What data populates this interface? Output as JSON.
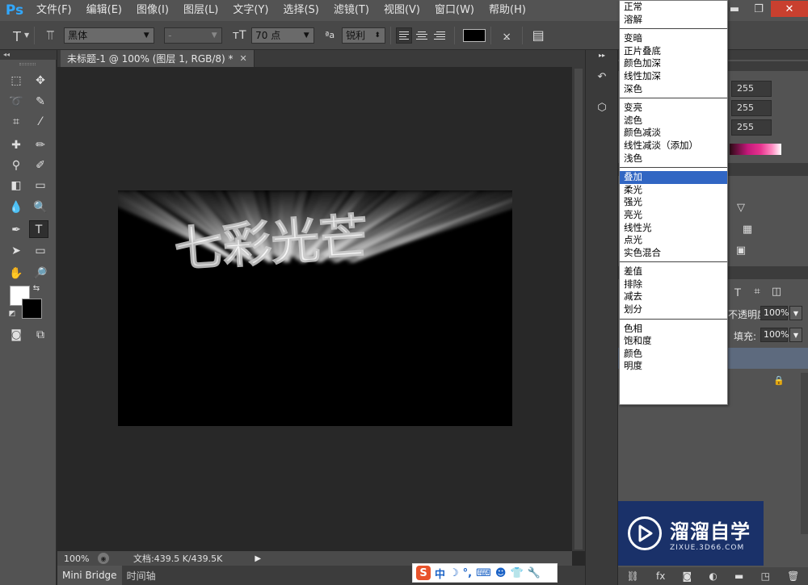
{
  "app": {
    "logo": "Ps"
  },
  "menubar": {
    "items": [
      "文件(F)",
      "编辑(E)",
      "图像(I)",
      "图层(L)",
      "文字(Y)",
      "选择(S)",
      "滤镜(T)",
      "视图(V)",
      "窗口(W)",
      "帮助(H)"
    ]
  },
  "options": {
    "font_family": "黑体",
    "font_style": "-",
    "font_size": "70 点",
    "aa_label": "ªa",
    "anti_alias": "锐利",
    "text_color": "#000000"
  },
  "document": {
    "tab_title": "未标题-1 @ 100% (图层 1, RGB/8) *",
    "canvas_text": "七彩光芒"
  },
  "status": {
    "zoom": "100%",
    "doc_size": "文档:439.5 K/439.5K"
  },
  "bottom_tabs": [
    "Mini Bridge",
    "时间轴"
  ],
  "ime": {
    "logo": "S",
    "mode": "中",
    "items": [
      "☽",
      "°,",
      "⌨",
      "☻",
      "👕",
      "🔧"
    ]
  },
  "color_panel": {
    "r": "255",
    "g": "255",
    "b": "255"
  },
  "layers_panel": {
    "opacity_label": "不透明度:",
    "opacity": "100%",
    "fill_label": "填充:",
    "fill": "100%"
  },
  "blend_modes": {
    "groups": [
      [
        "正常",
        "溶解"
      ],
      [
        "变暗",
        "正片叠底",
        "颜色加深",
        "线性加深",
        "深色"
      ],
      [
        "变亮",
        "滤色",
        "颜色减淡",
        "线性减淡（添加）",
        "浅色"
      ],
      [
        "叠加",
        "柔光",
        "强光",
        "亮光",
        "线性光",
        "点光",
        "实色混合"
      ],
      [
        "差值",
        "排除",
        "减去",
        "划分"
      ],
      [
        "色相",
        "饱和度",
        "颜色",
        "明度"
      ]
    ],
    "selected": "叠加"
  },
  "watermark": {
    "title": "溜溜自学",
    "subtitle": "ZIXUE.3D66.COM"
  },
  "colors": {
    "accent": "#31a8ff",
    "selection": "#3166c3",
    "layer_selected": "#5d6a7e"
  }
}
